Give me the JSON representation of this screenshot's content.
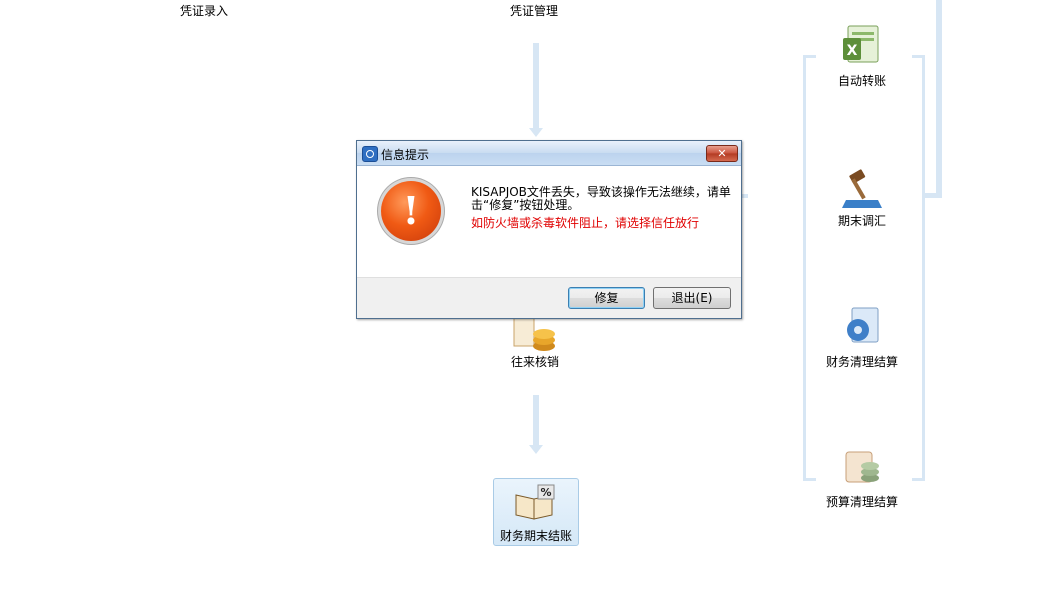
{
  "flow": {
    "voucher_entry": "凭证录入",
    "voucher_management": "凭证管理",
    "auto_transfer": "自动转账",
    "period_end_adjust": "期末调汇",
    "account_reconcile": "往来核销",
    "financial_clearing": "财务清理结算",
    "budget_clearing": "预算清理结算",
    "period_end_close": "财务期末结账"
  },
  "dialog": {
    "title": "信息提示",
    "close_label": "✕",
    "message": "KISAPJOB文件丢失，导致该操作无法继续，请单击“修复”按钮处理。",
    "warning": "如防火墙或杀毒软件阻止，请选择信任放行",
    "repair_label": "修复",
    "exit_label": "退出(E)"
  },
  "colors": {
    "flow_line": "#d7e6f4",
    "warning_text": "#e00000",
    "alert_icon": "#f05a14"
  }
}
